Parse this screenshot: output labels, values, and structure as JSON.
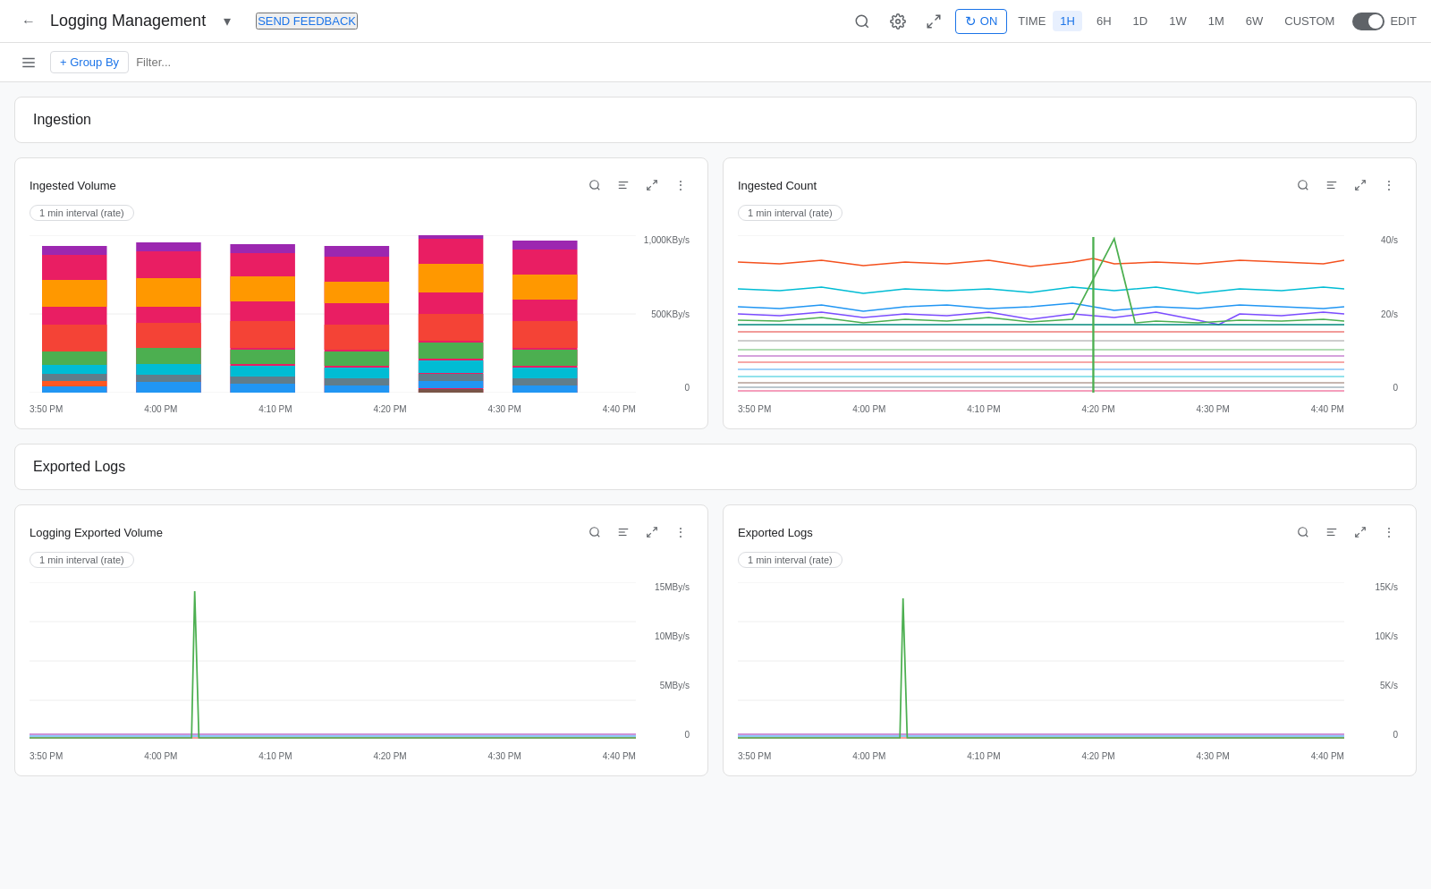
{
  "header": {
    "back_icon": "←",
    "title": "Logging Management",
    "dropdown_icon": "▾",
    "send_feedback": "SEND FEEDBACK",
    "refresh_label": "ON",
    "time_label": "TIME",
    "time_options": [
      "1H",
      "6H",
      "1D",
      "1W",
      "1M",
      "6W",
      "CUSTOM"
    ],
    "active_time": "1H",
    "edit_label": "EDIT",
    "icons": {
      "search": "🔍",
      "settings": "⚙",
      "fullscreen": "⛶",
      "refresh": "↻"
    }
  },
  "filter_bar": {
    "group_by_label": "+ Group By",
    "filter_placeholder": "Filter..."
  },
  "sections": [
    {
      "id": "ingestion",
      "title": "Ingestion",
      "charts": [
        {
          "id": "ingested-volume",
          "title": "Ingested Volume",
          "interval": "1 min interval (rate)",
          "y_labels": [
            "1,000KBy/s",
            "500KBy/s",
            "0"
          ],
          "x_labels": [
            "3:50 PM",
            "4:00 PM",
            "4:10 PM",
            "4:20 PM",
            "4:30 PM",
            "4:40 PM"
          ],
          "type": "stacked-bar"
        },
        {
          "id": "ingested-count",
          "title": "Ingested Count",
          "interval": "1 min interval (rate)",
          "y_labels": [
            "40/s",
            "20/s",
            "0"
          ],
          "x_labels": [
            "3:50 PM",
            "4:00 PM",
            "4:10 PM",
            "4:20 PM",
            "4:30 PM",
            "4:40 PM"
          ],
          "type": "multi-line"
        }
      ]
    },
    {
      "id": "exported-logs",
      "title": "Exported Logs",
      "charts": [
        {
          "id": "logging-exported-volume",
          "title": "Logging Exported Volume",
          "interval": "1 min interval (rate)",
          "y_labels": [
            "15MBy/s",
            "10MBy/s",
            "5MBy/s",
            "0"
          ],
          "x_labels": [
            "3:50 PM",
            "4:00 PM",
            "4:10 PM",
            "4:20 PM",
            "4:30 PM",
            "4:40 PM"
          ],
          "type": "spike-line"
        },
        {
          "id": "exported-logs-chart",
          "title": "Exported Logs",
          "interval": "1 min interval (rate)",
          "y_labels": [
            "15K/s",
            "10K/s",
            "5K/s",
            "0"
          ],
          "x_labels": [
            "3:50 PM",
            "4:00 PM",
            "4:10 PM",
            "4:20 PM",
            "4:30 PM",
            "4:40 PM"
          ],
          "type": "spike-line"
        }
      ]
    }
  ],
  "colors": {
    "primary": "#1a73e8",
    "accent": "#1a73e8",
    "border": "#e0e0e0",
    "background": "#f8f9fa"
  }
}
